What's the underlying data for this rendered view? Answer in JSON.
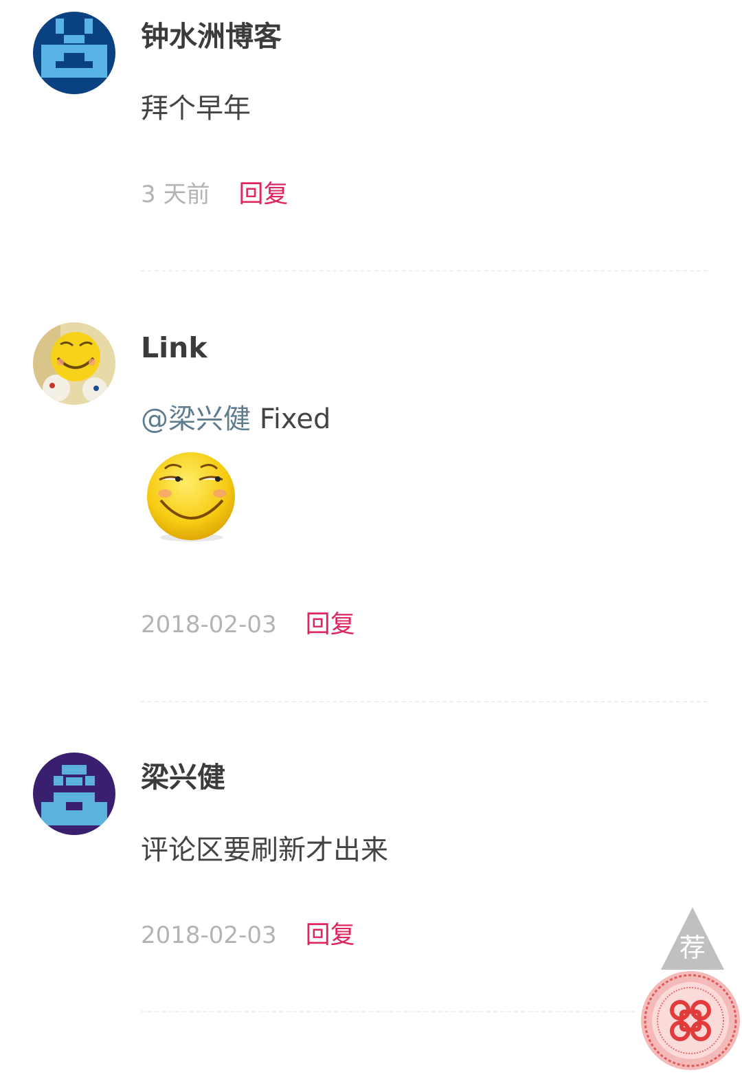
{
  "comments": [
    {
      "author": "钟水洲博客",
      "avatar_icon": "pixel-identicon-blue",
      "avatar_colors": {
        "bg": "#0a4180",
        "fg": "#58b4e4"
      },
      "text": "拜个早年",
      "time": "3 天前",
      "reply_label": "回复"
    },
    {
      "author": "Link",
      "avatar_icon": "smirk-face-avatar",
      "mention": "@梁兴健",
      "text": "Fixed",
      "emoji_icon": "smirk-emoji",
      "time": "2018-02-03",
      "reply_label": "回复"
    },
    {
      "author": "梁兴健",
      "avatar_icon": "pixel-identicon-purple",
      "avatar_colors": {
        "bg": "#3a1f6e",
        "fg": "#5bb3dd"
      },
      "text": "评论区要刷新才出来",
      "time": "2018-02-03",
      "reply_label": "回复"
    }
  ],
  "float_widget": {
    "button_label": "荐",
    "button_icon": "up-triangle-icon",
    "stamp_icon": "china-unicom-knot-stamp"
  },
  "colors": {
    "author": "#3b3b3b",
    "text": "#444444",
    "time": "#b3b3b3",
    "reply": "#e0245e",
    "mention": "#5f7c8e"
  }
}
